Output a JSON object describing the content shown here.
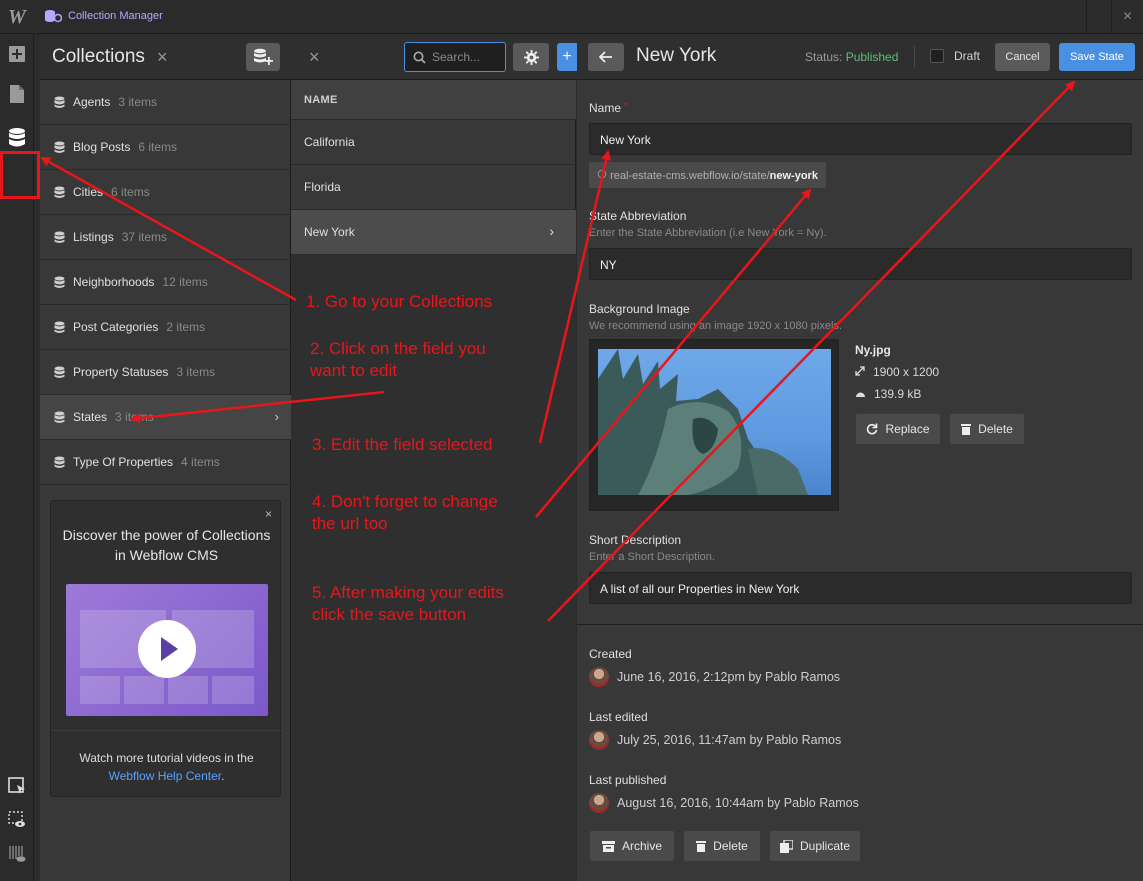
{
  "topbar": {
    "logo": "W",
    "app_title": "Collection Manager",
    "close": "×"
  },
  "collections": {
    "title": "Collections",
    "close": "×",
    "items": [
      {
        "label": "Agents",
        "count": "3 items"
      },
      {
        "label": "Blog Posts",
        "count": "6 items"
      },
      {
        "label": "Cities",
        "count": "6 items"
      },
      {
        "label": "Listings",
        "count": "37 items"
      },
      {
        "label": "Neighborhoods",
        "count": "12 items"
      },
      {
        "label": "Post Categories",
        "count": "2 items"
      },
      {
        "label": "Property Statuses",
        "count": "3 items"
      },
      {
        "label": "States",
        "count": "3 items"
      },
      {
        "label": "Type Of Properties",
        "count": "4 items"
      }
    ],
    "active_chevron": "›"
  },
  "promo": {
    "close": "×",
    "title": "Discover the power of Collections in Webflow CMS",
    "footer_text": "Watch more tutorial videos in the",
    "link": "Webflow Help Center",
    "link_suffix": "."
  },
  "items_panel": {
    "close": "×",
    "search_placeholder": "Search...",
    "plus": "+",
    "column": "NAME",
    "rows": [
      "California",
      "Florida",
      "New York"
    ],
    "active_chevron": "›"
  },
  "annotations": {
    "step1": "1. Go to your Collections",
    "step2_line1": "2. Click on the field you",
    "step2_line2": "want to edit",
    "step3": "3. Edit the field selected",
    "step4_line1": "4. Don't forget to change",
    "step4_line2": "the url too",
    "step5_line1": "5. After making your edits",
    "step5_line2": "click the save button",
    "color": "#e8161b"
  },
  "editor": {
    "title": "New York",
    "status_label": "Status:",
    "status_value": "Published",
    "draft_label": "Draft",
    "cancel": "Cancel",
    "save": "Save State",
    "name_label": "Name",
    "required_mark": "*",
    "name_value": "New York",
    "slug_prefix": "real-estate-cms.webflow.io/state/",
    "slug_value": "new-york",
    "abbr_label": "State Abbreviation",
    "abbr_help": "Enter the State Abbreviation (i.e New York = Ny).",
    "abbr_value": "NY",
    "bg_label": "Background Image",
    "bg_help": "We recommend using an image 1920 x 1080 pixels.",
    "img_name": "Ny.jpg",
    "img_dims": "1900 x 1200",
    "img_size": "139.9 kB",
    "replace": "Replace",
    "delete": "Delete",
    "short_label": "Short Description",
    "short_help": "Enter a Short Description.",
    "short_value": "A list of all our Properties in New York",
    "created_label": "Created",
    "created_value": "June 16, 2016, 2:12pm by Pablo Ramos",
    "edited_label": "Last edited",
    "edited_value": "July 25, 2016, 11:47am by Pablo Ramos",
    "published_label": "Last published",
    "published_value": "August 16, 2016, 10:44am by Pablo Ramos",
    "archive": "Archive",
    "delete_item": "Delete",
    "duplicate": "Duplicate"
  },
  "colors": {
    "accent": "#4a90e2",
    "published": "#5bbf7a",
    "annotation": "#e8161b",
    "brand": "#b9a6ff"
  }
}
